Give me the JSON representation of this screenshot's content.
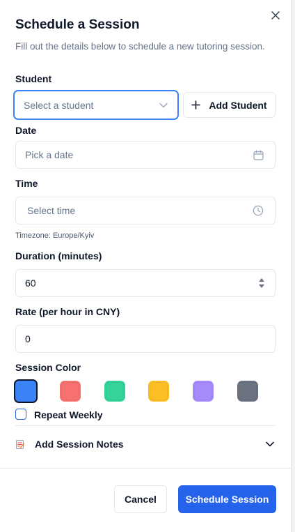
{
  "dialog": {
    "title": "Schedule a Session",
    "description": "Fill out the details below to schedule a new tutoring session."
  },
  "student": {
    "label": "Student",
    "placeholder": "Select a student",
    "add_button": "Add Student"
  },
  "date": {
    "label": "Date",
    "placeholder": "Pick a date"
  },
  "time": {
    "label": "Time",
    "placeholder": "Select time",
    "timezone": "Timezone: Europe/Kyiv"
  },
  "duration": {
    "label": "Duration (minutes)",
    "value": "60"
  },
  "rate": {
    "label": "Rate (per hour in CNY)",
    "value": "0"
  },
  "color": {
    "label": "Session Color",
    "options": [
      "#3b82f6",
      "#f87171",
      "#34d399",
      "#fbbf24",
      "#a78bfa",
      "#6b7280"
    ],
    "selected_index": 0
  },
  "repeat": {
    "label": "Repeat Weekly",
    "checked": false
  },
  "notes": {
    "label": "Add Session Notes",
    "icon": "memo-icon"
  },
  "footer": {
    "cancel_label": "Cancel",
    "submit_label": "Schedule Session"
  }
}
